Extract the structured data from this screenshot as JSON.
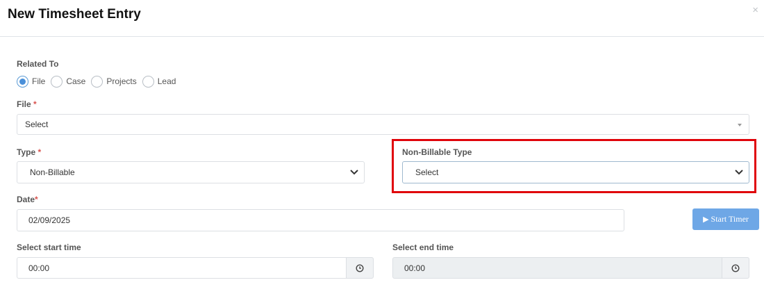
{
  "modal": {
    "title": "New Timesheet Entry",
    "close_symbol": "×"
  },
  "related_to": {
    "label": "Related To",
    "options": [
      {
        "label": "File",
        "checked": true
      },
      {
        "label": "Case",
        "checked": false
      },
      {
        "label": "Projects",
        "checked": false
      },
      {
        "label": "Lead",
        "checked": false
      }
    ]
  },
  "file": {
    "label": "File",
    "required_mark": "*",
    "value": "Select"
  },
  "type": {
    "label": "Type",
    "required_mark": "*",
    "value": "Non-Billable"
  },
  "non_billable_type": {
    "label": "Non-Billable Type",
    "value": "Select"
  },
  "date": {
    "label": "Date",
    "required_mark": "*",
    "value": "02/09/2025"
  },
  "start_timer": {
    "label": "Start Timer",
    "icon": "play-icon"
  },
  "start_time": {
    "label": "Select start time",
    "value": "00:00",
    "icon": "clock-icon"
  },
  "end_time": {
    "label": "Select end time",
    "value": "00:00",
    "icon": "clock-icon",
    "disabled": true
  },
  "colors": {
    "accent": "#4a90d9",
    "button": "#6ea7e6",
    "highlight": "#e0040b",
    "required": "#d9534f"
  }
}
